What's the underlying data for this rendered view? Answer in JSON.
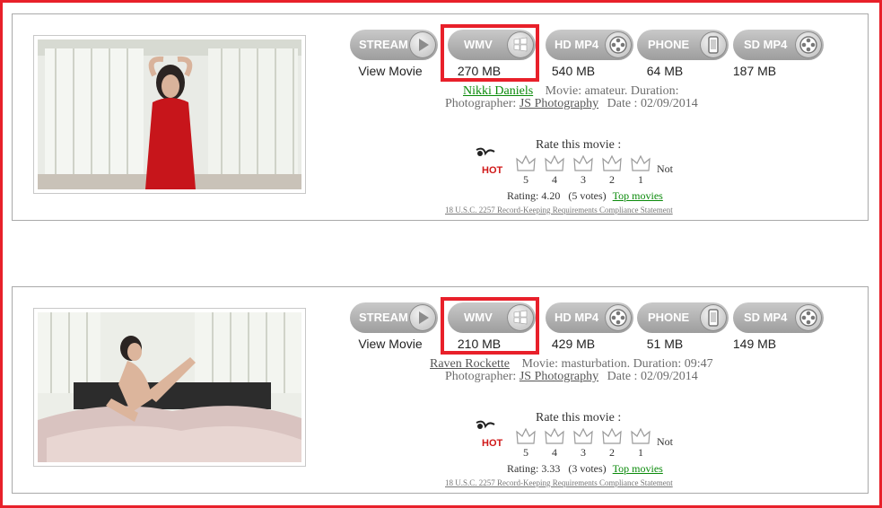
{
  "buttons": {
    "stream": "STREAM",
    "wmv": "WMV",
    "hd_mp4": "HD MP4",
    "phone": "PHONE",
    "sd_mp4": "SD MP4"
  },
  "rating_ui": {
    "rate_title": "Rate this movie :",
    "scores": [
      "5",
      "4",
      "3",
      "2",
      "1"
    ],
    "not_label": "Not",
    "hot_badge": "HOT",
    "legal": "18 U.S.C. 2257 Record-Keeping Requirements Compliance Statement",
    "top_movies": "Top movies"
  },
  "movies": [
    {
      "stream_label": "View Movie",
      "wmv_size": "270 MB",
      "hd_size": "540 MB",
      "phone_size": "64 MB",
      "sd_size": "187 MB",
      "model": "Nikki Daniels",
      "category_text": "Movie: amateur. Duration:",
      "photographer_label": "Photographer:",
      "photographer": "JS Photography",
      "date": "Date : 02/09/2014",
      "rating_text": "Rating: 4.20",
      "votes": "(5 votes)"
    },
    {
      "stream_label": "View Movie",
      "wmv_size": "210 MB",
      "hd_size": "429 MB",
      "phone_size": "51 MB",
      "sd_size": "149 MB",
      "model": "Raven Rockette",
      "category_text": "Movie: masturbation. Duration: 09:47",
      "photographer_label": "Photographer:",
      "photographer": "JS Photography",
      "date": "Date : 02/09/2014",
      "rating_text": "Rating: 3.33",
      "votes": "(3 votes)"
    }
  ],
  "colors": {
    "highlight": "#e8202a",
    "link_green": "#0a8a0a",
    "button_gray": "#b3b3b3"
  },
  "icons": {
    "stream": "play-icon",
    "wmv": "windows-icon",
    "hd_mp4": "film-reel-icon",
    "phone": "phone-icon",
    "sd_mp4": "film-reel-icon"
  }
}
